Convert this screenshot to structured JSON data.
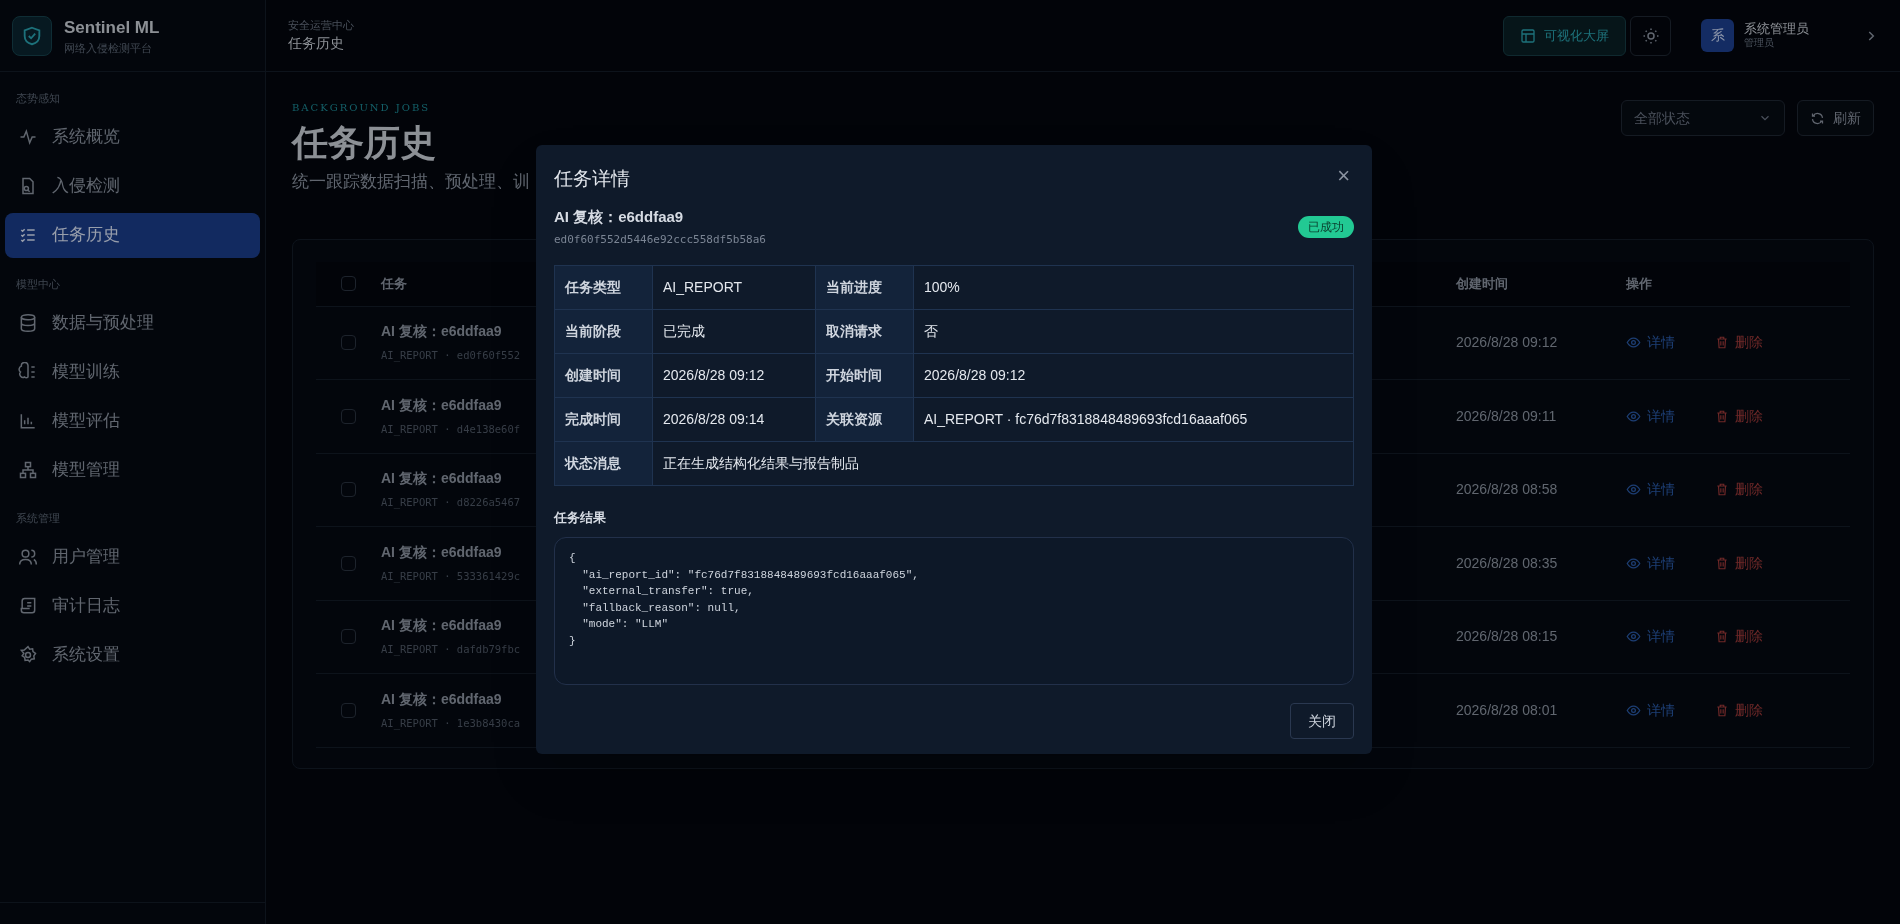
{
  "brand": {
    "name": "Sentinel ML",
    "subtitle": "网络入侵检测平台"
  },
  "sidebar": {
    "sections": [
      {
        "title": "态势感知",
        "items": [
          {
            "label": "系统概览",
            "selected": false
          },
          {
            "label": "入侵检测",
            "selected": false
          },
          {
            "label": "任务历史",
            "selected": true
          }
        ]
      },
      {
        "title": "模型中心",
        "items": [
          {
            "label": "数据与预处理",
            "selected": false
          },
          {
            "label": "模型训练",
            "selected": false
          },
          {
            "label": "模型评估",
            "selected": false
          },
          {
            "label": "模型管理",
            "selected": false
          }
        ]
      },
      {
        "title": "系统管理",
        "items": [
          {
            "label": "用户管理",
            "selected": false
          },
          {
            "label": "审计日志",
            "selected": false
          },
          {
            "label": "系统设置",
            "selected": false
          }
        ]
      }
    ]
  },
  "header": {
    "breadcrumb": "安全运营中心",
    "title": "任务历史",
    "screen_button": "可视化大屏",
    "user": {
      "avatar": "系",
      "name": "系统管理员",
      "role": "管理员"
    }
  },
  "page": {
    "eyebrow": "BACKGROUND JOBS",
    "title": "任务历史",
    "description": "统一跟踪数据扫描、预处理、训",
    "status_filter": "全部状态",
    "refresh_button": "刷新"
  },
  "table": {
    "select_all_checked": false,
    "columns": [
      "任务",
      "创建时间",
      "操作"
    ],
    "rows": [
      {
        "checked": false,
        "title": "AI 复核：e6ddfaa9",
        "subtitle": "AI_REPORT · ed0f60f552",
        "created": "2026/8/28 09:12",
        "view": "详情",
        "delete": "删除"
      },
      {
        "checked": false,
        "title": "AI 复核：e6ddfaa9",
        "subtitle": "AI_REPORT · d4e138e60f",
        "created": "2026/8/28 09:11",
        "view": "详情",
        "delete": "删除"
      },
      {
        "checked": false,
        "title": "AI 复核：e6ddfaa9",
        "subtitle": "AI_REPORT · d8226a5467",
        "created": "2026/8/28 08:58",
        "view": "详情",
        "delete": "删除"
      },
      {
        "checked": false,
        "title": "AI 复核：e6ddfaa9",
        "subtitle": "AI_REPORT · 533361429c",
        "created": "2026/8/28 08:35",
        "view": "详情",
        "delete": "删除"
      },
      {
        "checked": false,
        "title": "AI 复核：e6ddfaa9",
        "subtitle": "AI_REPORT · dafdb79fbc",
        "created": "2026/8/28 08:15",
        "view": "详情",
        "delete": "删除"
      },
      {
        "checked": false,
        "title": "AI 复核：e6ddfaa9",
        "subtitle": "AI_REPORT · 1e3b8430ca",
        "created": "2026/8/28 08:01",
        "view": "详情",
        "delete": "删除"
      }
    ]
  },
  "dialog": {
    "title": "任务详情",
    "close": "×",
    "job_title": "AI 复核：e6ddfaa9",
    "job_id": "ed0f60f552d5446e92ccc558df5b58a6",
    "status": "已成功",
    "details": [
      [
        {
          "label": "任务类型",
          "value": "AI_REPORT"
        },
        {
          "label": "当前进度",
          "value": "100%"
        }
      ],
      [
        {
          "label": "当前阶段",
          "value": "已完成"
        },
        {
          "label": "取消请求",
          "value": "否"
        }
      ],
      [
        {
          "label": "创建时间",
          "value": "2026/8/28 09:12"
        },
        {
          "label": "开始时间",
          "value": "2026/8/28 09:12"
        }
      ],
      [
        {
          "label": "完成时间",
          "value": "2026/8/28 09:14"
        },
        {
          "label": "关联资源",
          "value": "AI_REPORT · fc76d7f8318848489693fcd16aaaf065"
        }
      ],
      [
        {
          "label": "状态消息",
          "value": "正在生成结构化结果与报告制品"
        }
      ]
    ],
    "result_label": "任务结果",
    "result": "{\n  \"ai_report_id\": \"fc76d7f8318848489693fcd16aaaf065\",\n  \"external_transfer\": true,\n  \"fallback_reason\": null,\n  \"mode\": \"LLM\"\n}",
    "close_button": "关闭"
  }
}
